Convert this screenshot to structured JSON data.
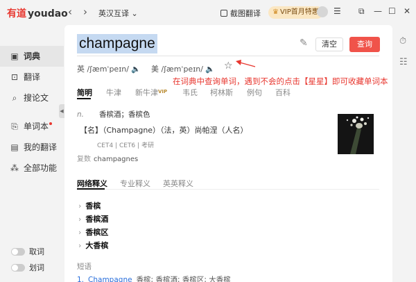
{
  "titlebar": {
    "logo_cn": "有道",
    "logo_en": "youdao",
    "back_icon": "chevron-left-icon",
    "forward_icon": "chevron-right-icon",
    "mode_label": "英汉互译",
    "screenshot_label": "截图翻译",
    "vip_label": "VIP首月特惠"
  },
  "sidebar": {
    "items": [
      {
        "label": "词典",
        "icon": "dictionary-icon",
        "active": true
      },
      {
        "label": "翻译",
        "icon": "translate-icon"
      },
      {
        "label": "搜论文",
        "icon": "paper-search-icon"
      },
      {
        "label": "单词本",
        "icon": "wordbook-icon"
      },
      {
        "label": "我的翻译",
        "icon": "my-translation-icon"
      },
      {
        "label": "全部功能",
        "icon": "all-features-icon"
      }
    ],
    "toggles": [
      {
        "label": "取词"
      },
      {
        "label": "划词"
      }
    ]
  },
  "main": {
    "query": "champagne",
    "clear_label": "清空",
    "lookup_label": "查询",
    "phonetic_uk_label": "英",
    "phonetic_uk": "/ʃæmˈpeɪn/",
    "phonetic_us_label": "美",
    "phonetic_us": "/ʃæmˈpeɪn/",
    "annotation": "在词典中查询单词，遇到不会的点击【星星】即可收藏单词本",
    "tabs": [
      "简明",
      "牛津",
      "新牛津",
      "韦氏",
      "柯林斯",
      "例句",
      "百科"
    ],
    "vip_tag": "VIP",
    "definition_pos": "n.",
    "definition": "香槟酒；香槟色",
    "name_entry": "【名】（Champagne）（法，英）尚帕涅（人名）",
    "exam_tags": [
      "CET4",
      "CET6",
      "考研"
    ],
    "plural_label": "复数",
    "plural_value": "champagnes",
    "section_tabs": [
      "网络释义",
      "专业释义",
      "英英释义"
    ],
    "web_items": [
      "香槟",
      "香槟酒",
      "香槟区",
      "大香槟"
    ],
    "phrase_title": "短语",
    "phrase": {
      "num": "1.",
      "en": "Champagne",
      "cn": "香槟; 香槟酒; 香槟区; 大香槟"
    }
  },
  "colors": {
    "accent": "#f0534a",
    "annotation": "#e8372f",
    "query_highlight": "#c5d9f1"
  }
}
